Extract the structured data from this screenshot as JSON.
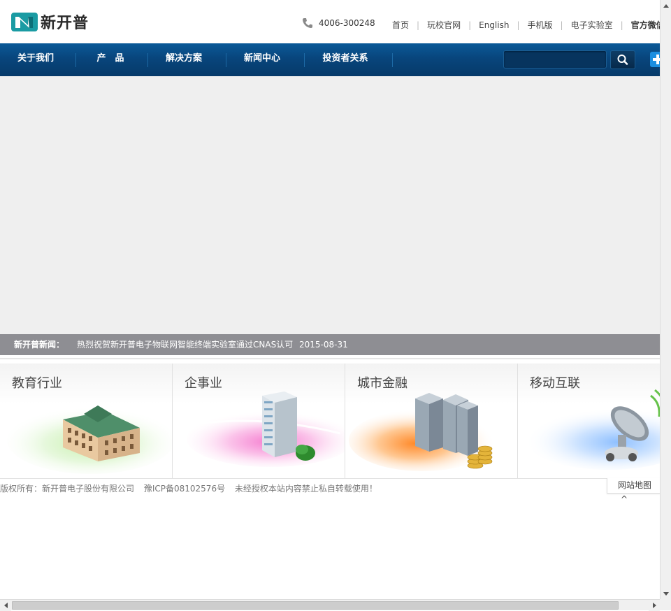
{
  "brand": {
    "name": "新开普",
    "logo_color": "#1a9ba3"
  },
  "header": {
    "phone": "4006-300248",
    "links": [
      {
        "label": "首页"
      },
      {
        "label": "玩校官网"
      },
      {
        "label": "English"
      },
      {
        "label": "手机版"
      },
      {
        "label": "电子实验室"
      },
      {
        "label": "官方微信"
      }
    ]
  },
  "nav": {
    "items": [
      {
        "label": "关于我们"
      },
      {
        "label": "产　品"
      },
      {
        "label": "解决方案"
      },
      {
        "label": "新闻中心"
      },
      {
        "label": "投资者关系"
      }
    ],
    "search": {
      "placeholder": "",
      "button_icon": "search-icon"
    },
    "extra_icon": "plus-icon",
    "colors": {
      "top": "#0b5a98",
      "bottom": "#063a69"
    }
  },
  "news": {
    "label": "新开普新闻：",
    "title": "热烈祝贺新开普电子物联网智能终端实验室通过CNAS认可",
    "date": "2015-08-31"
  },
  "industries": [
    {
      "title": "教育行业",
      "icon": "school-building-icon",
      "accent": "#7ad67a"
    },
    {
      "title": "企事业",
      "icon": "office-tower-icon",
      "accent": "#f06fc8"
    },
    {
      "title": "城市金融",
      "icon": "city-finance-icon",
      "accent": "#ff9a3a"
    },
    {
      "title": "移动互联",
      "icon": "satellite-dish-icon",
      "accent": "#7fb6f5"
    }
  ],
  "footer": {
    "copyright": "版权所有：新开普电子股份有限公司",
    "icp": "豫ICP备08102576号",
    "notice": "未经授权本站内容禁止私自转载使用！",
    "sitemap": "网站地图"
  }
}
